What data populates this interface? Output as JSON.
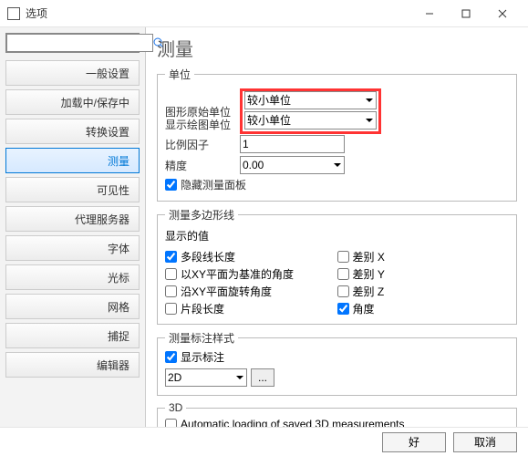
{
  "window": {
    "title": "选项"
  },
  "sidebar": {
    "search_placeholder": "",
    "items": [
      "一般设置",
      "加载中/保存中",
      "转换设置",
      "测量",
      "可见性",
      "代理服务器",
      "字体",
      "光标",
      "网格",
      "捕捉",
      "编辑器"
    ],
    "active_index": 3
  },
  "page": {
    "title": "测量",
    "units_group": "单位",
    "orig_unit_label": "图形原始单位",
    "disp_unit_label": "显示绘图单位",
    "unit_options": [
      "较小单位"
    ],
    "unit_selected": "较小单位",
    "scale_label": "比例因子",
    "scale_value": "1",
    "precision_label": "精度",
    "precision_options": [
      "0.00"
    ],
    "precision_selected": "0.00",
    "hide_panel": "隐藏测量面板",
    "poly_group": "测量多边形线",
    "show_values": "显示的值",
    "checks_left": [
      "多段线长度",
      "以XY平面为基准的角度",
      "沿XY平面旋转角度",
      "片段长度"
    ],
    "checks_right": [
      "差别 X",
      "差别 Y",
      "差别 Z",
      "角度"
    ],
    "check_values_left": [
      true,
      false,
      false,
      false
    ],
    "check_values_right": [
      false,
      false,
      false,
      true
    ],
    "anno_group": "测量标注样式",
    "show_anno": "显示标注",
    "anno_mode_options": [
      "2D"
    ],
    "anno_mode_selected": "2D",
    "more_btn": "...",
    "three_d_group": "3D",
    "auto3d": "Automatic loading of saved 3D measurements"
  },
  "footer": {
    "ok": "好",
    "cancel": "取消"
  }
}
